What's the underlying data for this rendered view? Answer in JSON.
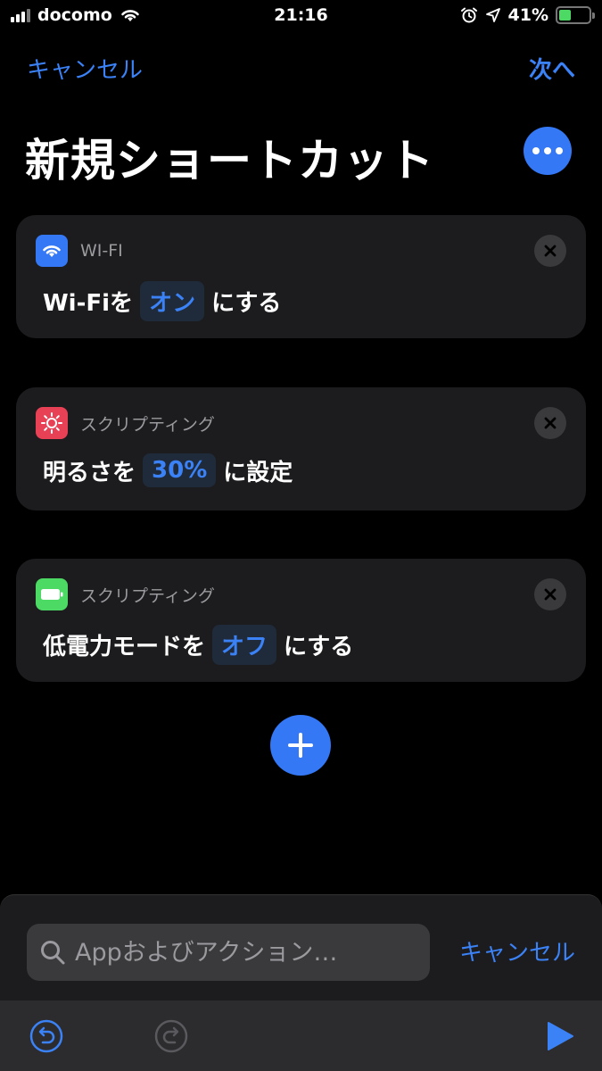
{
  "status_bar": {
    "carrier": "docomo",
    "time": "21:16",
    "battery_percent": "41%",
    "battery_level": 0.41,
    "icons": [
      "signal-icon",
      "wifi-icon",
      "alarm-icon",
      "location-icon",
      "battery-charging-icon"
    ]
  },
  "nav": {
    "cancel_label": "キャンセル",
    "next_label": "次へ"
  },
  "page_title": "新規ショートカット",
  "actions": [
    {
      "app": "WI-FI",
      "icon": "wifi-icon",
      "icon_color": "#3478f6",
      "text_before": "Wi-Fiを",
      "value": "オン",
      "text_after": "にする"
    },
    {
      "app": "スクリプティング",
      "icon": "brightness-icon",
      "icon_color": "#e84155",
      "text_before": "明るさを",
      "value": "30%",
      "text_after": "に設定"
    },
    {
      "app": "スクリプティング",
      "icon": "battery-icon",
      "icon_color": "#4cd964",
      "text_before": "低電力モードを",
      "value": "オフ",
      "text_after": "にする"
    }
  ],
  "search": {
    "placeholder": "Appおよびアクション…",
    "cancel_label": "キャンセル"
  },
  "colors": {
    "accent": "#3478f6",
    "card_bg": "#1c1c1e",
    "background": "#000000"
  }
}
